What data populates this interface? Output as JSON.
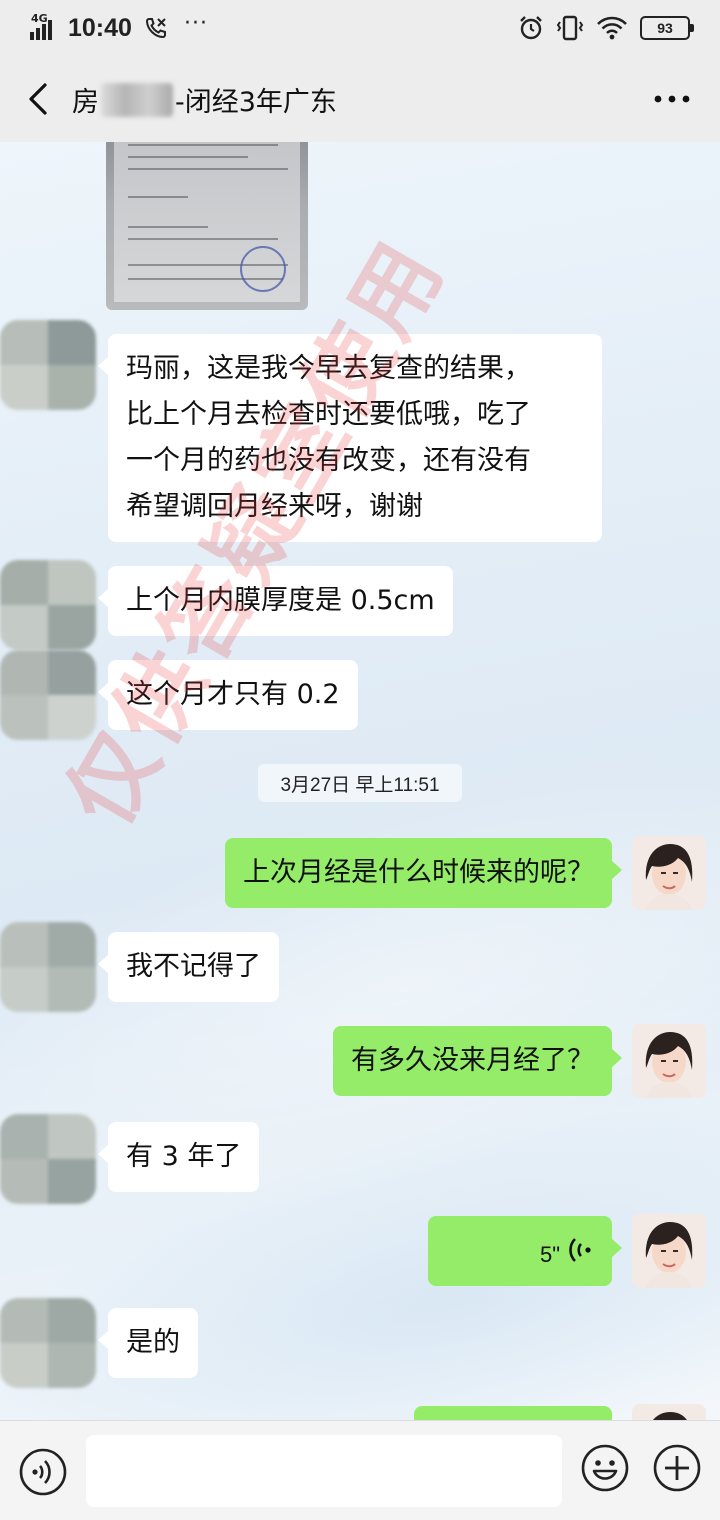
{
  "status_bar": {
    "network": "4G",
    "time": "10:40",
    "battery": "93",
    "icons": [
      "signal-icon",
      "call-icon",
      "more-notifications-icon",
      "alarm-icon",
      "vibrate-icon",
      "wifi-icon",
      "battery-icon"
    ]
  },
  "header": {
    "title_prefix": "房",
    "title_suffix": "-闭经3年广东",
    "back_icon": "back-chevron-icon",
    "more_icon": "more-dots-icon"
  },
  "messages": [
    {
      "id": "img1",
      "side": "in",
      "type": "image",
      "alt": "检查报告单"
    },
    {
      "id": "m1",
      "side": "in",
      "lines": [
        "玛丽，这是我今早去复查的结果，",
        "比上个月去检查时还要低哦，吃了",
        "一个月的药也没有改变，还有没有",
        "希望调回月经来呀，谢谢"
      ]
    },
    {
      "id": "m2",
      "side": "in",
      "text": "上个月内膜厚度是 0.5cm"
    },
    {
      "id": "m3",
      "side": "in",
      "text": "这个月才只有 0.2"
    },
    {
      "id": "m4",
      "side": "out",
      "text": "上次月经是什么时候来的呢？"
    },
    {
      "id": "m5",
      "side": "in",
      "text": "我不记得了"
    },
    {
      "id": "m6",
      "side": "out",
      "text": "有多久没来月经了？"
    },
    {
      "id": "m7",
      "side": "in",
      "text": "有 3 年了"
    },
    {
      "id": "m8",
      "side": "out",
      "type": "voice",
      "duration": "5\""
    },
    {
      "id": "m9",
      "side": "in",
      "text": "是的"
    }
  ],
  "timestamp": "3月27日 早上11:51",
  "watermark": "仅供答疑室使用",
  "input_bar": {
    "placeholder": "",
    "voice_icon": "voice-toggle-icon",
    "emoji_icon": "emoji-icon",
    "plus_icon": "plus-icon"
  },
  "colors": {
    "bubble_out": "#95ec69",
    "bubble_in": "#ffffff",
    "bar": "#ededed"
  }
}
